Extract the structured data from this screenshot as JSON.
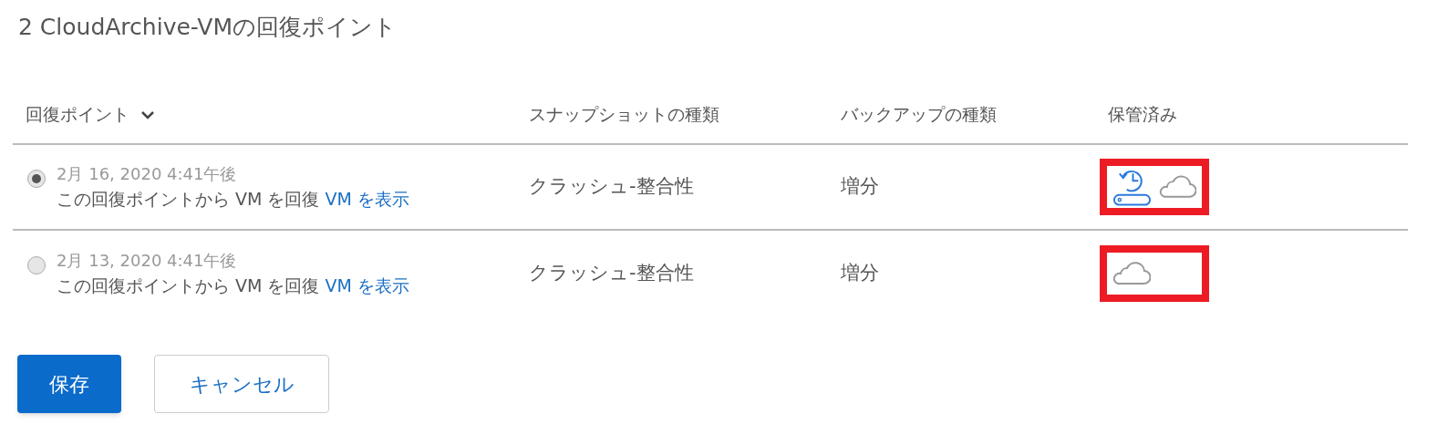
{
  "title": "2 CloudArchive-VMの回復ポイント",
  "table": {
    "columns": [
      {
        "label": "回復ポイント",
        "sortable": true
      },
      {
        "label": "スナップショットの種類"
      },
      {
        "label": "バックアップの種類"
      },
      {
        "label": "保管済み"
      }
    ],
    "rows": [
      {
        "selected": true,
        "date": "2月 16, 2020 4:41午後",
        "description": "この回復ポイントから VM を回復",
        "link": "VM を表示",
        "snapshot_type": "クラッシュ-整合性",
        "backup_type": "増分",
        "highlighted": true,
        "stored": [
          {
            "kind": "local"
          },
          {
            "kind": "cloud"
          }
        ]
      },
      {
        "selected": false,
        "date": "2月 13, 2020 4:41午後",
        "description": "この回復ポイントから VM を回復",
        "link": "VM を表示",
        "snapshot_type": "クラッシュ-整合性",
        "backup_type": "増分",
        "highlighted": true,
        "stored": [
          {
            "kind": "cloud"
          }
        ]
      }
    ]
  },
  "buttons": [
    {
      "label": "保存",
      "kind": "primary"
    },
    {
      "label": "キャンセル",
      "kind": "secondary"
    }
  ]
}
